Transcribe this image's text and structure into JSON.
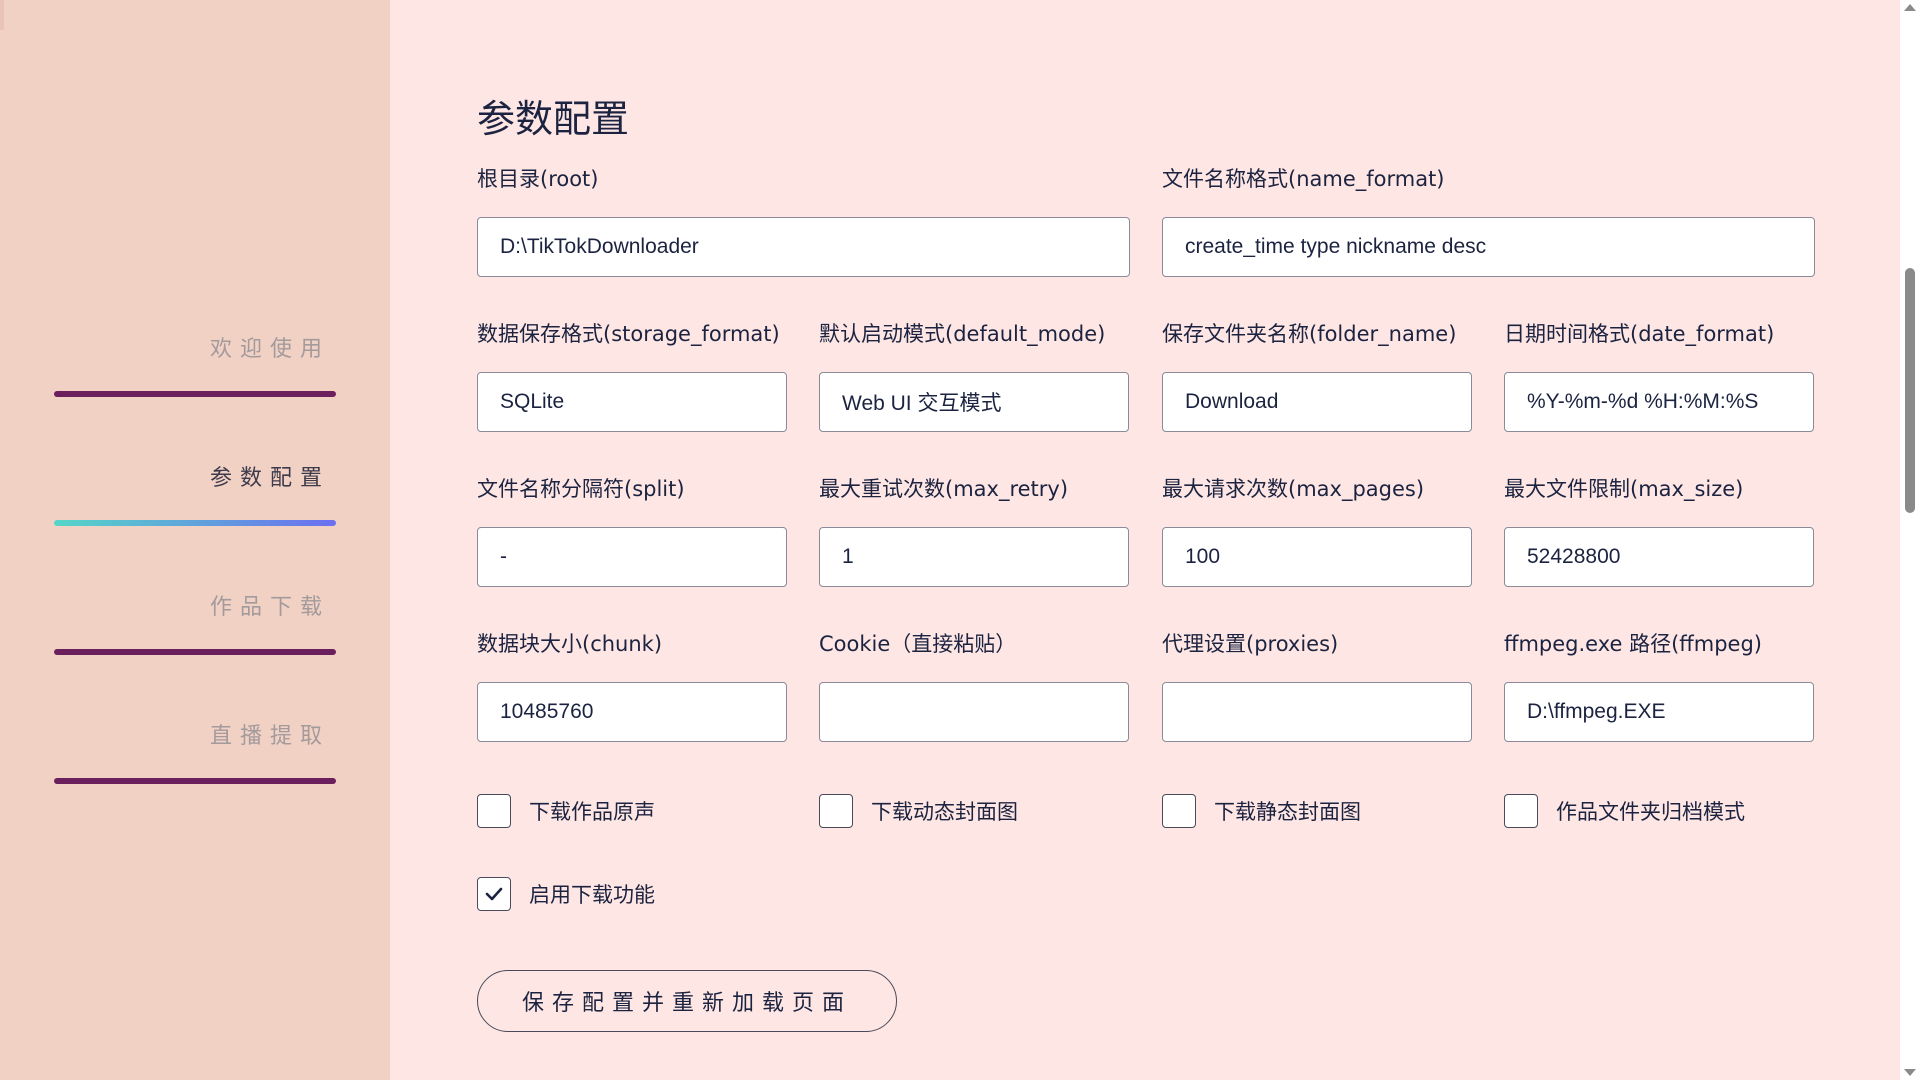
{
  "sidebar": {
    "items": [
      {
        "label": "欢迎使用",
        "active": false
      },
      {
        "label": "参数配置",
        "active": true
      },
      {
        "label": "作品下载",
        "active": false
      },
      {
        "label": "直播提取",
        "active": false
      }
    ]
  },
  "main": {
    "title": "参数配置",
    "fields": {
      "root": {
        "label": "根目录(root)",
        "value": "D:\\TikTokDownloader"
      },
      "name_format": {
        "label": "文件名称格式(name_format)",
        "value": "create_time type nickname desc"
      },
      "storage_format": {
        "label": "数据保存格式(storage_format)",
        "value": "SQLite"
      },
      "default_mode": {
        "label": "默认启动模式(default_mode)",
        "value": "Web UI 交互模式"
      },
      "folder_name": {
        "label": "保存文件夹名称(folder_name)",
        "value": "Download"
      },
      "date_format": {
        "label": "日期时间格式(date_format)",
        "value": "%Y-%m-%d %H:%M:%S"
      },
      "split": {
        "label": "文件名称分隔符(split)",
        "value": "-"
      },
      "max_retry": {
        "label": "最大重试次数(max_retry)",
        "value": "1"
      },
      "max_pages": {
        "label": "最大请求次数(max_pages)",
        "value": "100"
      },
      "max_size": {
        "label": "最大文件限制(max_size)",
        "value": "52428800"
      },
      "chunk": {
        "label": "数据块大小(chunk)",
        "value": "10485760"
      },
      "cookie": {
        "label": "Cookie（直接粘贴）",
        "value": ""
      },
      "proxies": {
        "label": "代理设置(proxies)",
        "value": ""
      },
      "ffmpeg": {
        "label": "ffmpeg.exe 路径(ffmpeg)",
        "value": "D:\\ffmpeg.EXE"
      }
    },
    "checkboxes": {
      "music": {
        "label": "下载作品原声",
        "checked": false
      },
      "dynamic_cover": {
        "label": "下载动态封面图",
        "checked": false
      },
      "static_cover": {
        "label": "下载静态封面图",
        "checked": false
      },
      "folder_mode": {
        "label": "作品文件夹归档模式",
        "checked": false
      },
      "download": {
        "label": "启用下载功能",
        "checked": true
      }
    },
    "save_button": "保存配置并重新加载页面"
  },
  "icons": {
    "check": "check-icon",
    "scroll_up": "arrow-up-icon",
    "scroll_down": "arrow-down-icon"
  }
}
